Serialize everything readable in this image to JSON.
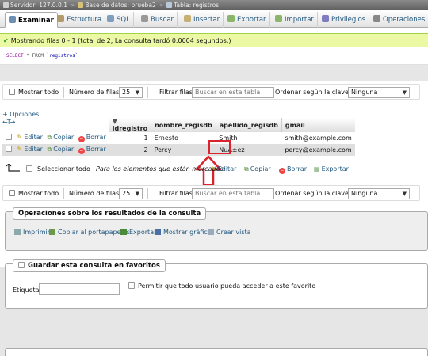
{
  "breadcrumb": {
    "server": "Servidor: 127.0.0.1",
    "database": "Base de datos: prueba2",
    "table": "Tabla: registros"
  },
  "tabs": [
    {
      "label": "Examinar",
      "active": true
    },
    {
      "label": "Estructura"
    },
    {
      "label": "SQL"
    },
    {
      "label": "Buscar"
    },
    {
      "label": "Insertar"
    },
    {
      "label": "Exportar"
    },
    {
      "label": "Importar"
    },
    {
      "label": "Privilegios"
    },
    {
      "label": "Operaciones"
    }
  ],
  "success_message": "Mostrando filas 0 - 1 (total de 2, La consulta tardó 0.0004 segundos.)",
  "sql": {
    "keyword": "SELECT",
    "rest": " * FROM ",
    "table": "`registros`"
  },
  "nav": {
    "show_all": "Mostrar todo",
    "rows_label": "Número de filas:",
    "rows_value": "25",
    "filter_label": "Filtrar filas:",
    "filter_placeholder": "Buscar en esta tabla",
    "sort_label": "Ordenar según la clave:",
    "sort_value": "Ninguna"
  },
  "options_link": "+ Opciones",
  "sort_arrows": "←T→",
  "columns": [
    "idregistro",
    "nombre_regisdb",
    "apellido_regisdb",
    "gmail"
  ],
  "row_actions": {
    "edit": "Editar",
    "copy": "Copiar",
    "delete": "Borrar"
  },
  "rows": [
    {
      "idregistro": "1",
      "nombre": "Ernesto",
      "apellido": "Smith",
      "gmail": "smith@example.com"
    },
    {
      "idregistro": "2",
      "nombre": "Percy",
      "apellido": "NuÃ±ez",
      "gmail": "percy@example.com"
    }
  ],
  "bulk": {
    "select_all": "Seleccionar todo",
    "marked_label": "Para los elementos que están marcados:",
    "edit": "Editar",
    "copy": "Copiar",
    "delete": "Borrar",
    "export": "Exportar"
  },
  "query_ops": {
    "legend": "Operaciones sobre los resultados de la consulta",
    "print": "Imprimir",
    "copy_clipboard": "Copiar al portapapeles",
    "export": "Exportar",
    "chart": "Mostrar gráfico",
    "create_view": "Crear vista"
  },
  "bookmark": {
    "legend": "Guardar esta consulta en favoritos",
    "label_field": "Etiqueta:",
    "public_checkbox": "Permitir que todo usuario pueda acceder a este favorito"
  },
  "colors": {
    "accent_link": "#235a81",
    "success_bg": "#ebf8a4",
    "highlight": "#d9232d"
  }
}
